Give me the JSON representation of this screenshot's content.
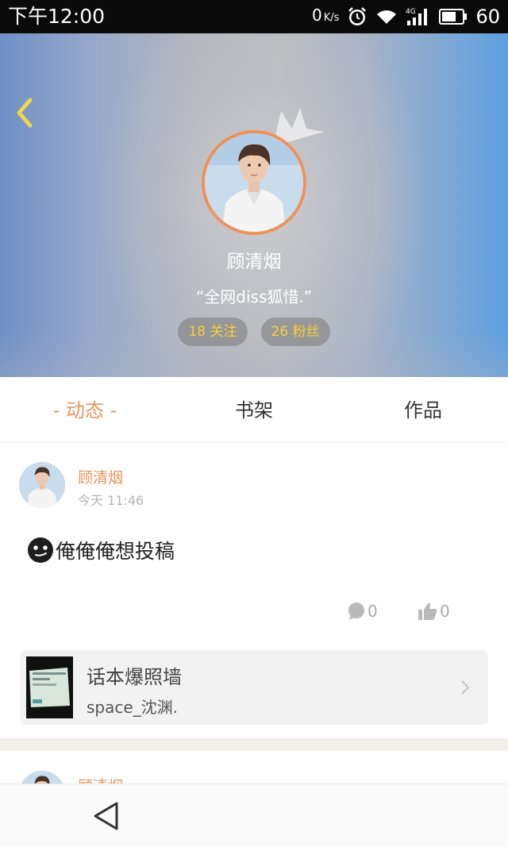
{
  "status_bar": {
    "time": "下午12:00",
    "net_speed": "0",
    "net_unit": "K/s",
    "network_type": "4G",
    "battery": "60",
    "icons": [
      "alarm-icon",
      "wifi-icon",
      "signal-icon",
      "battery-icon"
    ]
  },
  "profile": {
    "name": "顾清烟",
    "motto": "“全网diss狐惜.”",
    "following": "18 关注",
    "followers": "26 粉丝",
    "accent_color": "#e8955a",
    "pill_text_color": "#f5cf3a"
  },
  "tabs": [
    {
      "label": "- 动态 -",
      "active": true
    },
    {
      "label": "书架",
      "active": false
    },
    {
      "label": "作品",
      "active": false
    }
  ],
  "post": {
    "author": "顾清烟",
    "time": "今天 11:46",
    "text": "俺俺俺想投稿",
    "comment_count": "0",
    "like_count": "0",
    "book": {
      "title": "话本爆照墙",
      "subtitle": "space_沈渊."
    }
  },
  "next_post": {
    "author": "顾清烟"
  }
}
